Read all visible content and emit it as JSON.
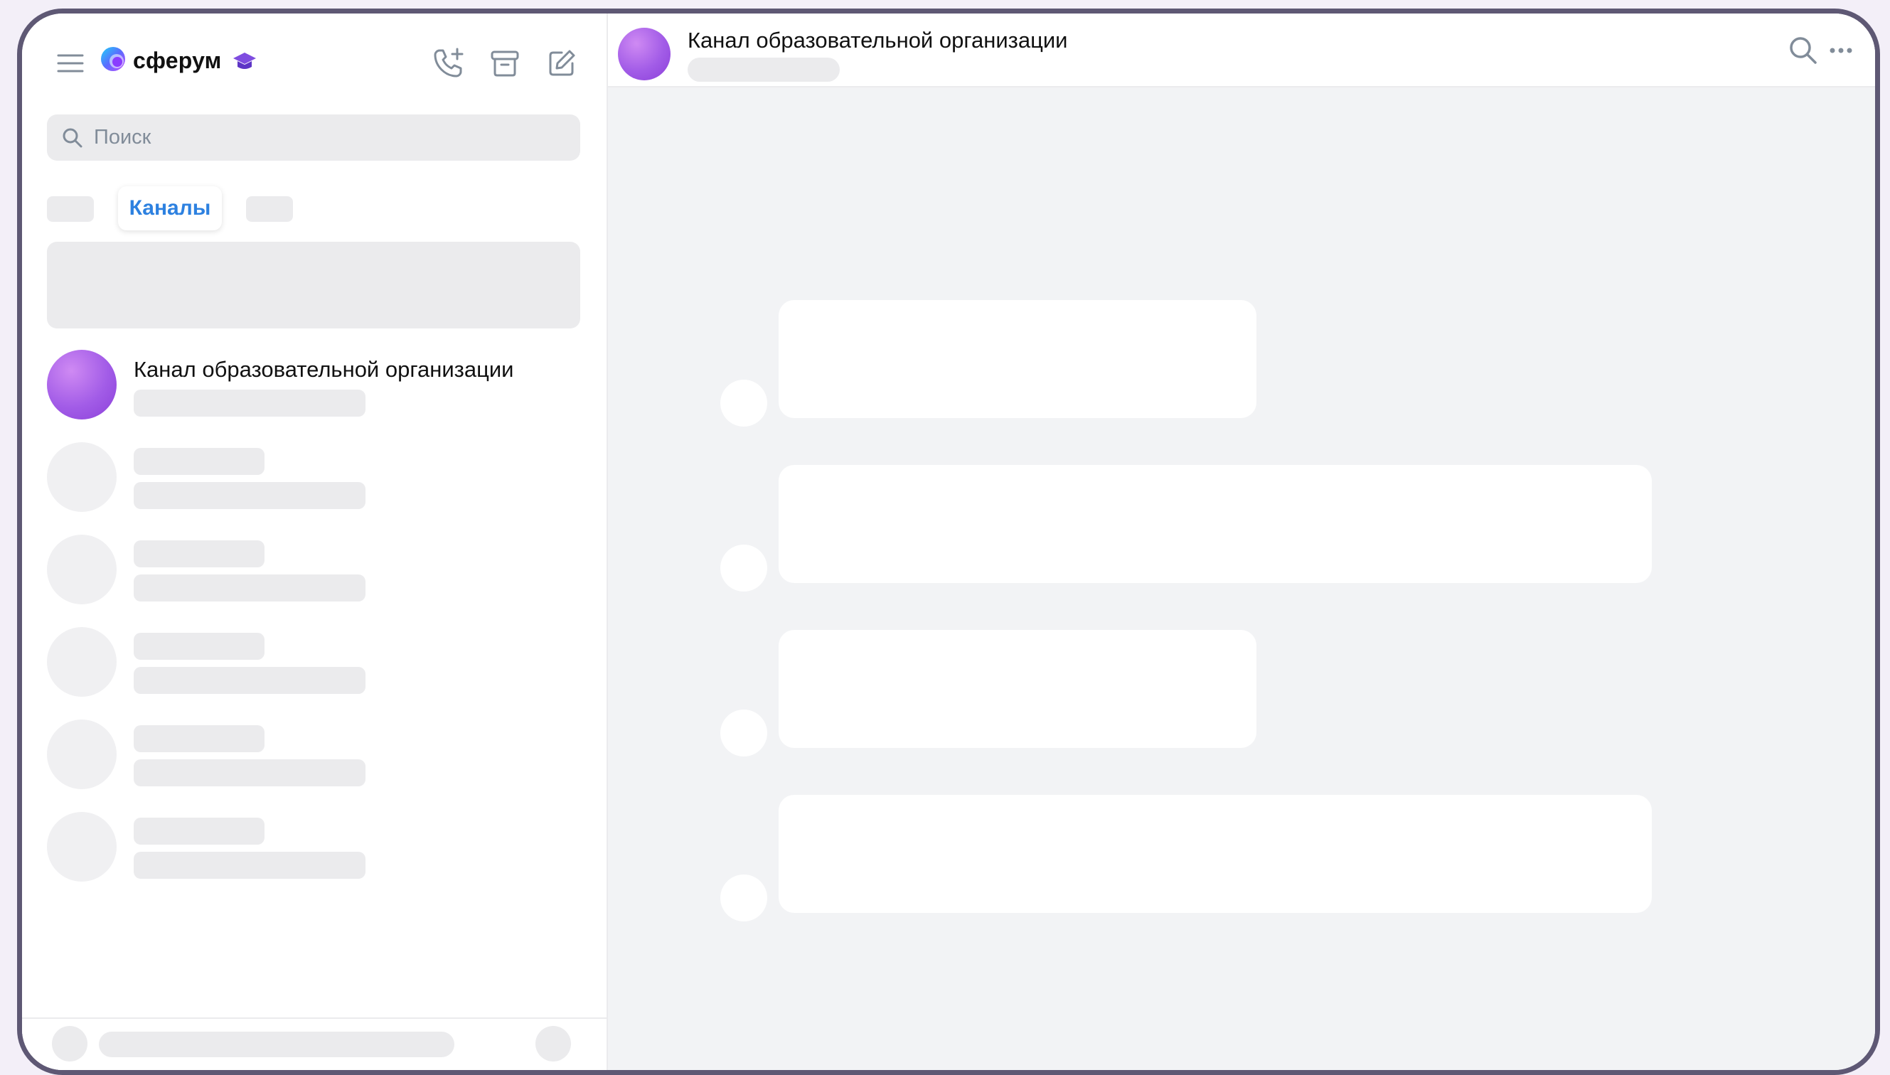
{
  "app": {
    "logo_text": "сферум"
  },
  "sidebar": {
    "search": {
      "placeholder": "Поиск"
    },
    "tabs": {
      "active_label": "Каналы"
    },
    "chats": [
      {
        "title": "Канал образовательной организации",
        "avatar_color": "#a25ce7"
      }
    ]
  },
  "header": {
    "title": "Канал образовательной организации"
  },
  "colors": {
    "accent": "#2d81e0",
    "channel_avatar": "#a25ce7",
    "skeleton": "#ebebed",
    "chat_background": "#f2f3f5",
    "frame": "#5e5874"
  },
  "icons": [
    "menu-icon",
    "sferum-logo-icon",
    "graduation-cap-icon",
    "add-call-icon",
    "archive-icon",
    "compose-icon",
    "search-icon",
    "more-icon"
  ]
}
